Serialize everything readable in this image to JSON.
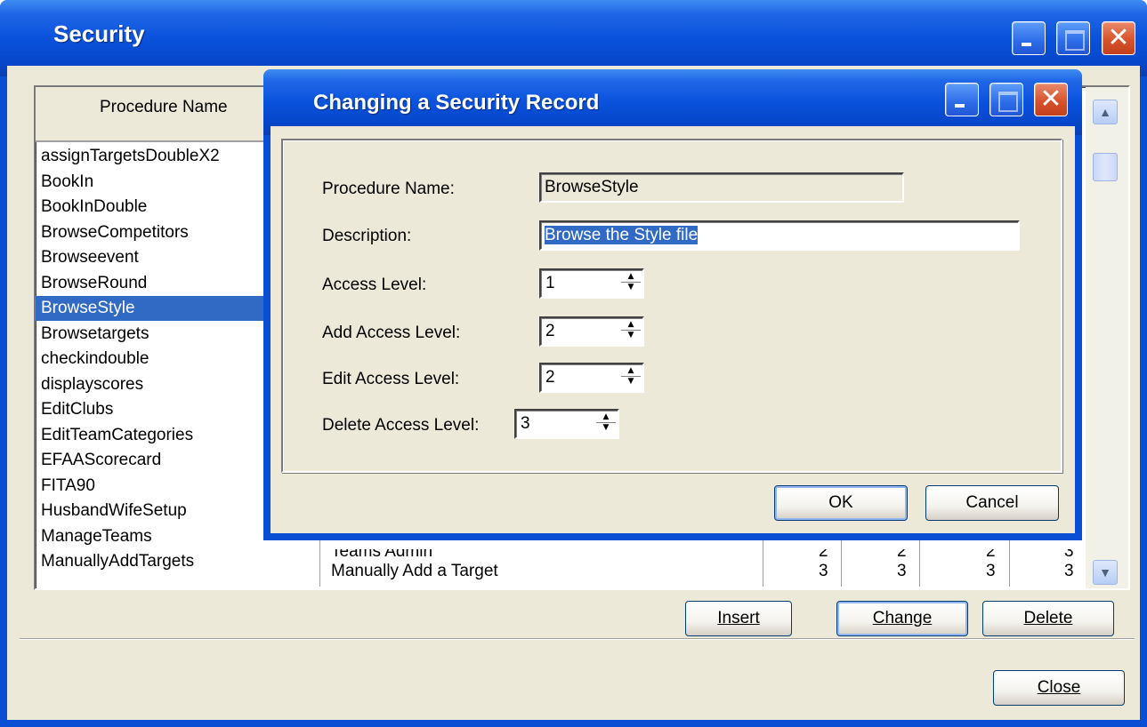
{
  "main_window": {
    "title": "Security",
    "list": {
      "column_header": "Procedure Name",
      "rows": [
        "assignTargetsDoubleX2",
        "BookIn",
        "BookInDouble",
        "BrowseCompetitors",
        "Browseevent",
        "BrowseRound",
        "BrowseStyle",
        "Browsetargets",
        "checkindouble",
        "displayscores",
        "EditClubs",
        "EditTeamCategories",
        "EFAAScorecard",
        "FITA90",
        "HusbandWifeSetup",
        "ManageTeams",
        "ManuallyAddTargets"
      ],
      "selected_index": 6,
      "partial_row_manage_teams": {
        "description": "Teams Admin",
        "values": [
          "2",
          "2",
          "2",
          "3"
        ]
      },
      "row_manually_add": {
        "description": "Manually Add a Target",
        "values": [
          "3",
          "3",
          "3",
          "3"
        ]
      }
    },
    "buttons": {
      "insert": "Insert",
      "change": "Change",
      "delete": "Delete",
      "close": "Close"
    }
  },
  "dialog": {
    "title": "Changing a Security Record",
    "fields": {
      "procedure_name_label": "Procedure Name:",
      "procedure_name_value": "BrowseStyle",
      "description_label": "Description:",
      "description_value": "Browse the Style file",
      "access_level_label": "Access Level:",
      "access_level_value": "1",
      "add_access_level_label": "Add Access Level:",
      "add_access_level_value": "2",
      "edit_access_level_label": "Edit Access Level:",
      "edit_access_level_value": "2",
      "delete_access_level_label": "Delete Access Level:",
      "delete_access_level_value": "3"
    },
    "buttons": {
      "ok": "OK",
      "cancel": "Cancel"
    }
  },
  "colors": {
    "titlebar": "#0a52dc",
    "selection": "#316ac5",
    "client": "#ece9d8",
    "close_button": "#d7532b"
  }
}
